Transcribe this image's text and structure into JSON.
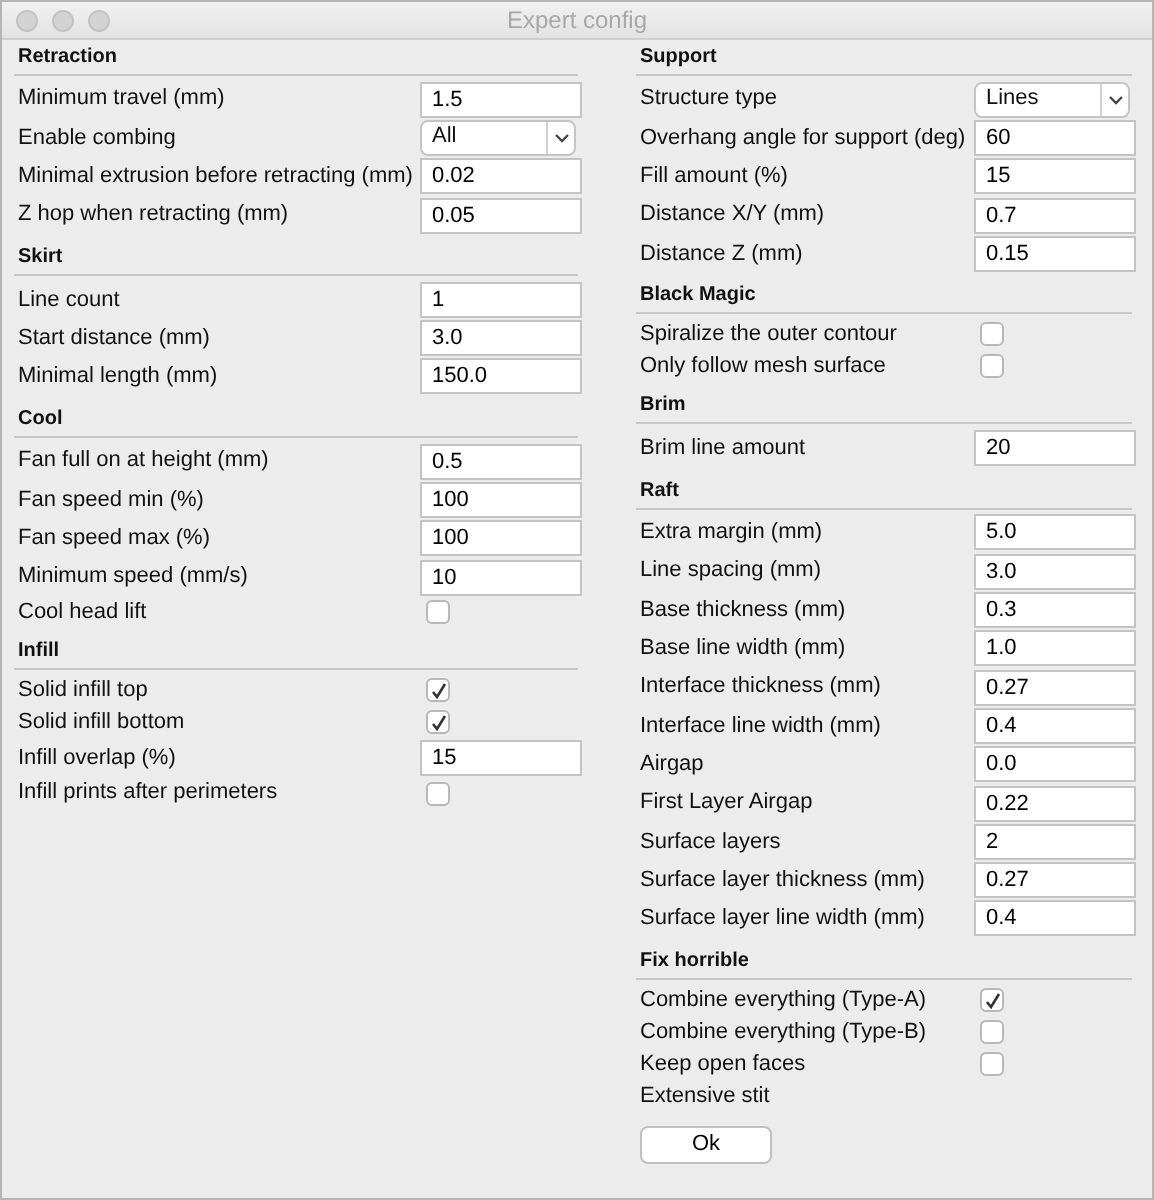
{
  "window": {
    "title": "Expert config"
  },
  "columns": [
    {
      "sections": [
        {
          "title": "Retraction",
          "rows": [
            {
              "label": "Minimum travel (mm)",
              "kind": "text",
              "value": "1.5"
            },
            {
              "label": "Enable combing",
              "kind": "select",
              "value": "All"
            },
            {
              "label": "Minimal extrusion before retracting (mm)",
              "kind": "text",
              "value": "0.02"
            },
            {
              "label": "Z hop when retracting (mm)",
              "kind": "text",
              "value": "0.05"
            }
          ]
        },
        {
          "title": "Skirt",
          "rows": [
            {
              "label": "Line count",
              "kind": "text",
              "value": "1"
            },
            {
              "label": "Start distance (mm)",
              "kind": "text",
              "value": "3.0"
            },
            {
              "label": "Minimal length (mm)",
              "kind": "text",
              "value": "150.0"
            }
          ]
        },
        {
          "title": "Cool",
          "rows": [
            {
              "label": "Fan full on at height (mm)",
              "kind": "text",
              "value": "0.5"
            },
            {
              "label": "Fan speed min (%)",
              "kind": "text",
              "value": "100"
            },
            {
              "label": "Fan speed max (%)",
              "kind": "text",
              "value": "100"
            },
            {
              "label": "Minimum speed (mm/s)",
              "kind": "text",
              "value": "10"
            },
            {
              "label": "Cool head lift",
              "kind": "check",
              "checked": false
            }
          ]
        },
        {
          "title": "Infill",
          "rows": [
            {
              "label": "Solid infill top",
              "kind": "check",
              "checked": true
            },
            {
              "label": "Solid infill bottom",
              "kind": "check",
              "checked": true
            },
            {
              "label": "Infill overlap (%)",
              "kind": "text",
              "value": "15"
            },
            {
              "label": "Infill prints after perimeters",
              "kind": "check",
              "checked": false
            }
          ]
        }
      ]
    },
    {
      "sections": [
        {
          "title": "Support",
          "rows": [
            {
              "label": "Structure type",
              "kind": "select",
              "value": "Lines"
            },
            {
              "label": "Overhang angle for support (deg)",
              "kind": "text",
              "value": "60"
            },
            {
              "label": "Fill amount (%)",
              "kind": "text",
              "value": "15"
            },
            {
              "label": "Distance X/Y (mm)",
              "kind": "text",
              "value": "0.7"
            },
            {
              "label": "Distance Z (mm)",
              "kind": "text",
              "value": "0.15"
            }
          ]
        },
        {
          "title": "Black Magic",
          "rows": [
            {
              "label": "Spiralize the outer contour",
              "kind": "check",
              "checked": false
            },
            {
              "label": "Only follow mesh surface",
              "kind": "check",
              "checked": false
            }
          ]
        },
        {
          "title": "Brim",
          "rows": [
            {
              "label": "Brim line amount",
              "kind": "text",
              "value": "20"
            }
          ]
        },
        {
          "title": "Raft",
          "rows": [
            {
              "label": "Extra margin (mm)",
              "kind": "text",
              "value": "5.0"
            },
            {
              "label": "Line spacing (mm)",
              "kind": "text",
              "value": "3.0"
            },
            {
              "label": "Base thickness (mm)",
              "kind": "text",
              "value": "0.3"
            },
            {
              "label": "Base line width (mm)",
              "kind": "text",
              "value": "1.0"
            },
            {
              "label": "Interface thickness (mm)",
              "kind": "text",
              "value": "0.27"
            },
            {
              "label": "Interface line width (mm)",
              "kind": "text",
              "value": "0.4"
            },
            {
              "label": "Airgap",
              "kind": "text",
              "value": "0.0"
            },
            {
              "label": "First Layer Airgap",
              "kind": "text",
              "value": "0.22"
            },
            {
              "label": "Surface layers",
              "kind": "text",
              "value": "2"
            },
            {
              "label": "Surface layer thickness (mm)",
              "kind": "text",
              "value": "0.27"
            },
            {
              "label": "Surface layer line width (mm)",
              "kind": "text",
              "value": "0.4"
            }
          ]
        },
        {
          "title": "Fix horrible",
          "rows": [
            {
              "label": "Combine everything (Type-A)",
              "kind": "check",
              "checked": true
            },
            {
              "label": "Combine everything (Type-B)",
              "kind": "check",
              "checked": false
            },
            {
              "label": "Keep open faces",
              "kind": "check",
              "checked": false
            },
            {
              "label": "Extensive stit",
              "kind": "label"
            }
          ]
        }
      ],
      "button": "Ok"
    }
  ]
}
